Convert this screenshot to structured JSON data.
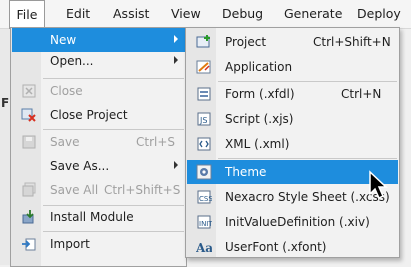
{
  "menubar": {
    "items": [
      "File",
      "Edit",
      "Assist",
      "View",
      "Debug",
      "Generate",
      "Deploy"
    ]
  },
  "background": {
    "label_fragment": "F"
  },
  "file_menu": {
    "items": [
      {
        "label": "New",
        "highlighted": true,
        "submenu": true,
        "icon": "new-icon"
      },
      {
        "label": "Open...",
        "submenu": true,
        "icon": "none"
      },
      {
        "label": "Close",
        "disabled": true,
        "icon": "close-doc-icon"
      },
      {
        "label": "Close Project",
        "icon": "close-project-icon"
      },
      {
        "label": "Save",
        "shortcut": "Ctrl+S",
        "disabled": true,
        "icon": "save-icon"
      },
      {
        "label": "Save As...",
        "submenu": true,
        "icon": "none"
      },
      {
        "label": "Save All",
        "shortcut": "Ctrl+Shift+S",
        "disabled": true,
        "icon": "save-all-icon"
      },
      {
        "label": "Install Module",
        "icon": "install-module-icon"
      },
      {
        "label": "Import",
        "icon": "import-icon"
      }
    ]
  },
  "new_submenu": {
    "items": [
      {
        "label": "Project",
        "shortcut": "Ctrl+Shift+N",
        "icon": "project-icon"
      },
      {
        "label": "Application",
        "icon": "application-icon"
      },
      {
        "label": "Form (.xfdl)",
        "shortcut": "Ctrl+N",
        "icon": "form-icon"
      },
      {
        "label": "Script (.xjs)",
        "icon": "script-icon"
      },
      {
        "label": "XML (.xml)",
        "icon": "xml-icon"
      },
      {
        "label": "Theme",
        "highlighted": true,
        "icon": "theme-icon"
      },
      {
        "label": "Nexacro Style Sheet (.xcss)",
        "icon": "css-icon"
      },
      {
        "label": "InitValueDefinition (.xiv)",
        "icon": "init-value-icon"
      },
      {
        "label": "UserFont (.xfont)",
        "icon": "font-icon"
      }
    ]
  },
  "colors": {
    "highlight": "#1e8ddd",
    "menu_bg": "#f2f2f2",
    "disabled_text": "#a0a0a0"
  }
}
